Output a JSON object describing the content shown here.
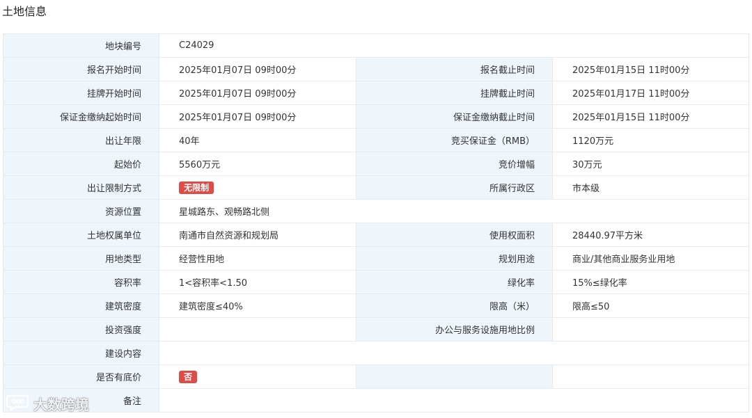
{
  "page_title": "土地信息",
  "colors": {
    "label_bg": "#eef5fb",
    "border": "#e3eaf0",
    "badge_red": "#df4b46"
  },
  "rows": [
    {
      "label": "地块编号",
      "value": "C24029"
    },
    {
      "label": "报名开始时间",
      "value": "2025年01月07日 09时00分",
      "label2": "报名截止时间",
      "value2": "2025年01月15日 11时00分"
    },
    {
      "label": "挂牌开始时间",
      "value": "2025年01月07日 09时00分",
      "label2": "挂牌截止时间",
      "value2": "2025年01月17日 11时00分"
    },
    {
      "label": "保证金缴纳起始时间",
      "value": "2025年01月07日 09时00分",
      "label2": "保证金缴纳截止时间",
      "value2": "2025年01月15日 11时00分"
    },
    {
      "label": "出让年限",
      "value": "40年",
      "label2": "竞买保证金（RMB）",
      "value2": "1120万元"
    },
    {
      "label": "起始价",
      "value": "5560万元",
      "label2": "竞价增幅",
      "value2": "30万元"
    },
    {
      "label": "出让限制方式",
      "value": "无限制",
      "label2": "所属行政区",
      "value2": "市本级"
    },
    {
      "label": "资源位置",
      "value": "星城路东、观畅路北侧"
    },
    {
      "label": "土地权属单位",
      "value": "南通市自然资源和规划局",
      "label2": "使用权面积",
      "value2": "28440.97平方米"
    },
    {
      "label": "用地类型",
      "value": "经营性用地",
      "label2": "规划用途",
      "value2": "商业/其他商业服务业用地"
    },
    {
      "label": "容积率",
      "value": "1<容积率<1.50",
      "label2": "绿化率",
      "value2": "15%≤绿化率"
    },
    {
      "label": "建筑密度",
      "value": "建筑密度≤40%",
      "label2": "限高（米）",
      "value2": "限高≤50"
    },
    {
      "label": "投资强度",
      "value": "",
      "label2": "办公与服务设施用地比例",
      "value2": ""
    },
    {
      "label": "建设内容",
      "value": ""
    },
    {
      "label": "是否有底价",
      "value": "否",
      "label2": "",
      "value2": ""
    },
    {
      "label": "备注",
      "value": ""
    }
  ],
  "watermark": {
    "text": "大数跨境",
    "icon": "chat-bubble-logo"
  }
}
